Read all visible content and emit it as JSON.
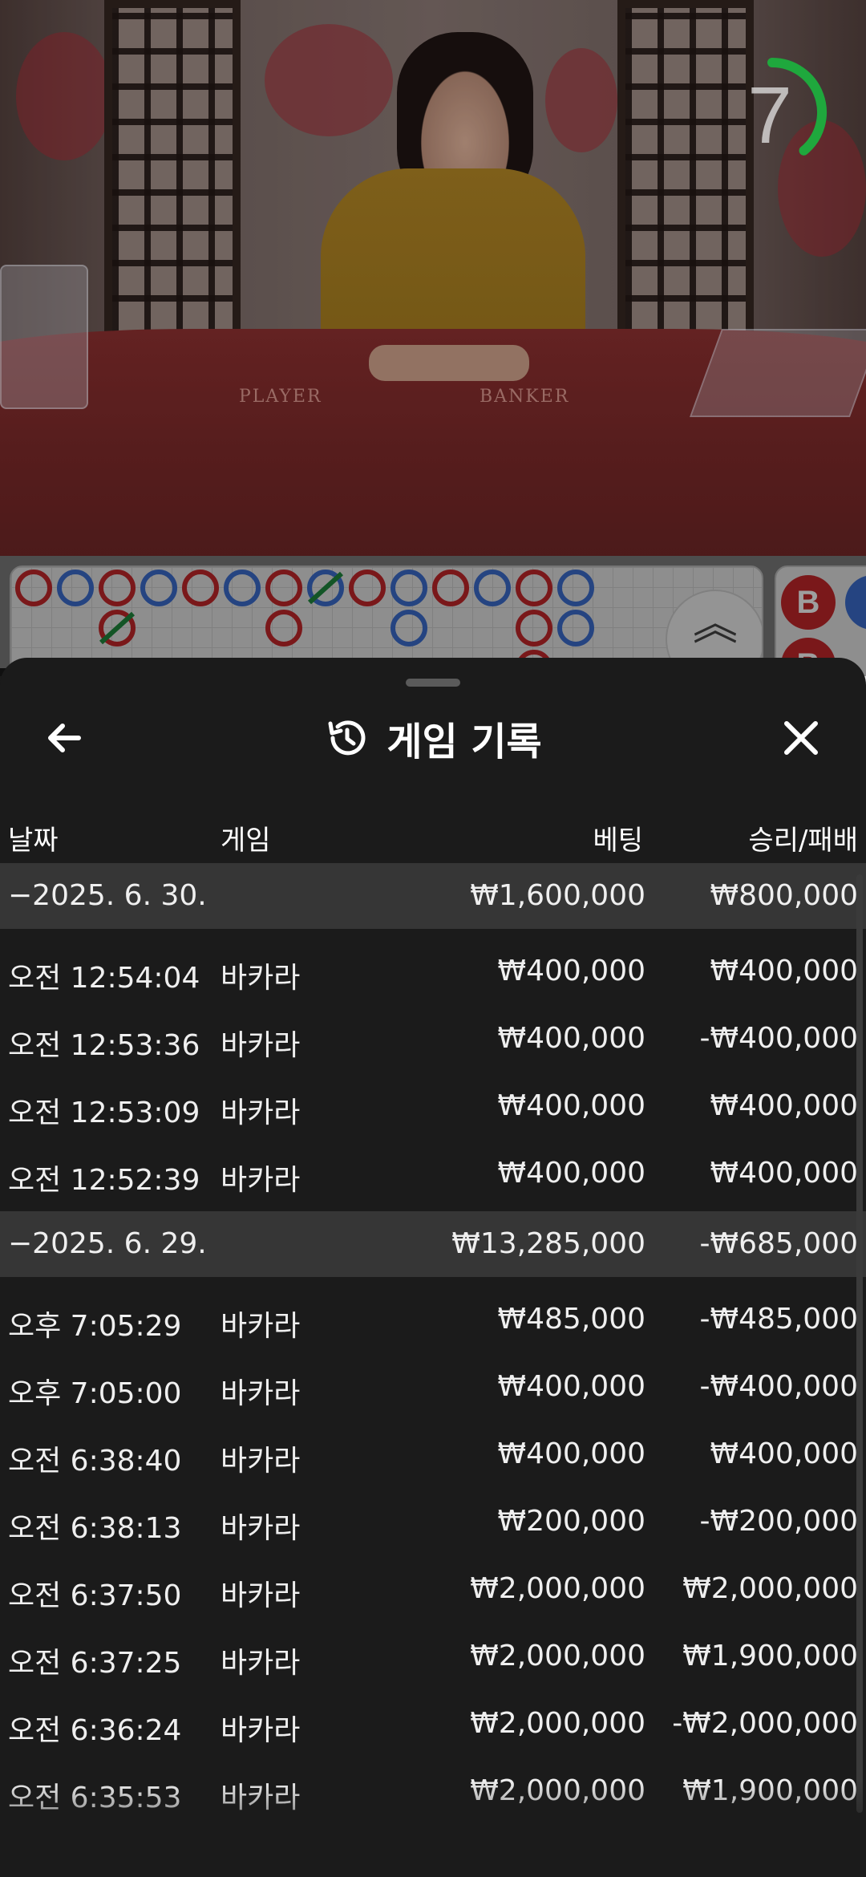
{
  "timer": {
    "value": "7",
    "progress": 0.3
  },
  "table_labels": {
    "player": "PLAYER",
    "banker": "BANKER"
  },
  "bead_labels": [
    "B",
    "B"
  ],
  "sheet": {
    "title": "게임 기록",
    "columns": {
      "date": "날짜",
      "game": "게임",
      "bet": "베팅",
      "win_loss": "승리/패배"
    },
    "rows": [
      {
        "type": "group",
        "date": "−2025. 6. 30.",
        "bet": "₩1,600,000",
        "win_loss": "₩800,000"
      },
      {
        "type": "item",
        "date": "오전 12:54:04",
        "game": "바카라",
        "bet": "₩400,000",
        "win_loss": "₩400,000"
      },
      {
        "type": "item",
        "date": "오전 12:53:36",
        "game": "바카라",
        "bet": "₩400,000",
        "win_loss": "-₩400,000"
      },
      {
        "type": "item",
        "date": "오전 12:53:09",
        "game": "바카라",
        "bet": "₩400,000",
        "win_loss": "₩400,000"
      },
      {
        "type": "item",
        "date": "오전 12:52:39",
        "game": "바카라",
        "bet": "₩400,000",
        "win_loss": "₩400,000"
      },
      {
        "type": "group",
        "date": "−2025. 6. 29.",
        "bet": "₩13,285,000",
        "win_loss": "-₩685,000"
      },
      {
        "type": "item",
        "date": "오후 7:05:29",
        "game": "바카라",
        "bet": "₩485,000",
        "win_loss": "-₩485,000"
      },
      {
        "type": "item",
        "date": "오후 7:05:00",
        "game": "바카라",
        "bet": "₩400,000",
        "win_loss": "-₩400,000"
      },
      {
        "type": "item",
        "date": "오전 6:38:40",
        "game": "바카라",
        "bet": "₩400,000",
        "win_loss": "₩400,000"
      },
      {
        "type": "item",
        "date": "오전 6:38:13",
        "game": "바카라",
        "bet": "₩200,000",
        "win_loss": "-₩200,000"
      },
      {
        "type": "item",
        "date": "오전 6:37:50",
        "game": "바카라",
        "bet": "₩2,000,000",
        "win_loss": "₩2,000,000"
      },
      {
        "type": "item",
        "date": "오전 6:37:25",
        "game": "바카라",
        "bet": "₩2,000,000",
        "win_loss": "₩1,900,000"
      },
      {
        "type": "item",
        "date": "오전 6:36:24",
        "game": "바카라",
        "bet": "₩2,000,000",
        "win_loss": "-₩2,000,000"
      },
      {
        "type": "item",
        "date": "오전 6:35:53",
        "game": "바카라",
        "bet": "₩2,000,000",
        "win_loss": "₩1,900,000"
      }
    ]
  },
  "colors": {
    "banker_red": "#c6272b",
    "player_blue": "#3d6fd1",
    "tie_green": "#1f8a3e",
    "sheet_bg": "#1b1b1b",
    "group_row_bg": "#363636",
    "timer_green": "#1fa83d"
  },
  "icons": {
    "back": "arrow-left-icon",
    "history": "history-icon",
    "close": "close-icon",
    "expand": "chevron-double-up-icon"
  }
}
